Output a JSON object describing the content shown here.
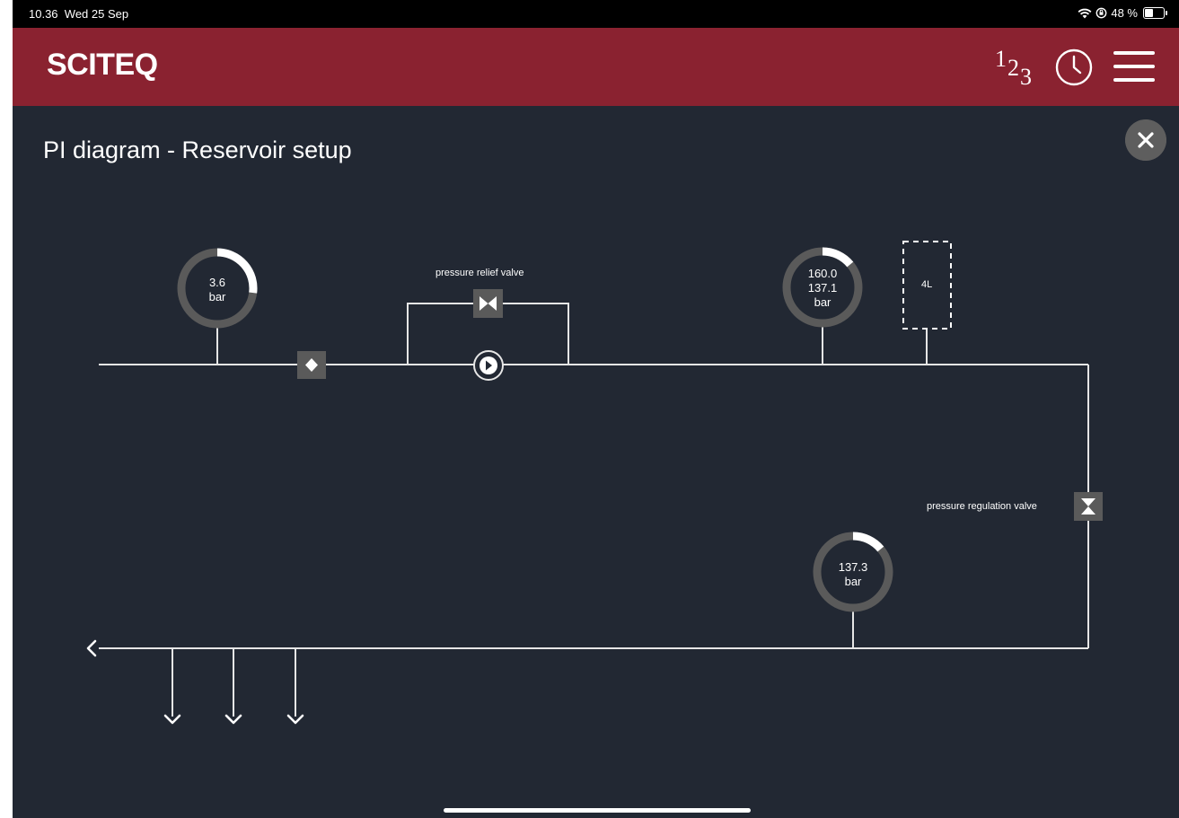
{
  "status_bar": {
    "time": "10.36",
    "date": "Wed 25 Sep",
    "battery": "48 %",
    "battery_level": 0.48
  },
  "header": {
    "logo": "SCITEQ",
    "counter_label": [
      "1",
      "2",
      "3"
    ],
    "icons": [
      "counter-icon",
      "history-clock-icon",
      "hamburger-menu-icon"
    ],
    "brand_color": "#8a2230"
  },
  "page": {
    "title": "PI diagram - Reservoir setup",
    "close_icon": "close-icon"
  },
  "diagram": {
    "gauge_inlet": {
      "value": "3.6",
      "unit": "bar",
      "fill": 0.27
    },
    "relief_valve_label": "pressure relief valve",
    "gauge_reservoir": {
      "value_top": "160.0",
      "value": "137.1",
      "unit": "bar",
      "fill": 0.14
    },
    "reservoir_label": "4L",
    "regulation_valve_label": "pressure regulation valve",
    "gauge_outlet": {
      "value": "137.3",
      "unit": "bar",
      "fill": 0.14
    },
    "colors": {
      "line": "#e6e6e6",
      "gauge_track": "#5a5a5a",
      "gauge_fill": "#ffffff",
      "background": "#222833"
    }
  }
}
